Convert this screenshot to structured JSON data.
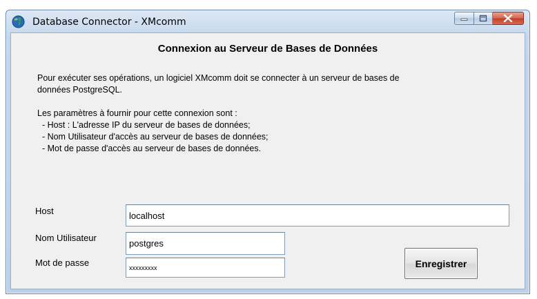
{
  "window": {
    "title": "Database Connector - XMcomm",
    "controls": {
      "minimize_icon": "minimize-icon",
      "maximize_icon": "maximize-icon",
      "close_icon": "close-icon"
    }
  },
  "content": {
    "heading": "Connexion au Serveur de Bases de Données",
    "intro_lines": [
      "Pour exécuter ses opérations, un logiciel XMcomm doit se connecter à un serveur de bases de",
      "données PostgreSQL."
    ],
    "params_intro": "Les paramètres à fournir pour cette connexion sont :",
    "params": [
      "  - Host : L'adresse IP du serveur de bases de données;",
      "  - Nom Utilisateur d'accès au serveur de bases de données;",
      "  - Mot de passe d'accès au serveur de bases de données."
    ]
  },
  "form": {
    "host_label": "Host",
    "host_value": "localhost",
    "user_label": "Nom Utilisateur",
    "user_value": "postgres",
    "password_label": "Mot de passe",
    "password_value": "xxxxxxxxx",
    "save_label": "Enregistrer"
  },
  "colors": {
    "title_bar": "#c4d7ec",
    "client_bg": "#f0f0f0",
    "close_button": "#c0402a"
  }
}
